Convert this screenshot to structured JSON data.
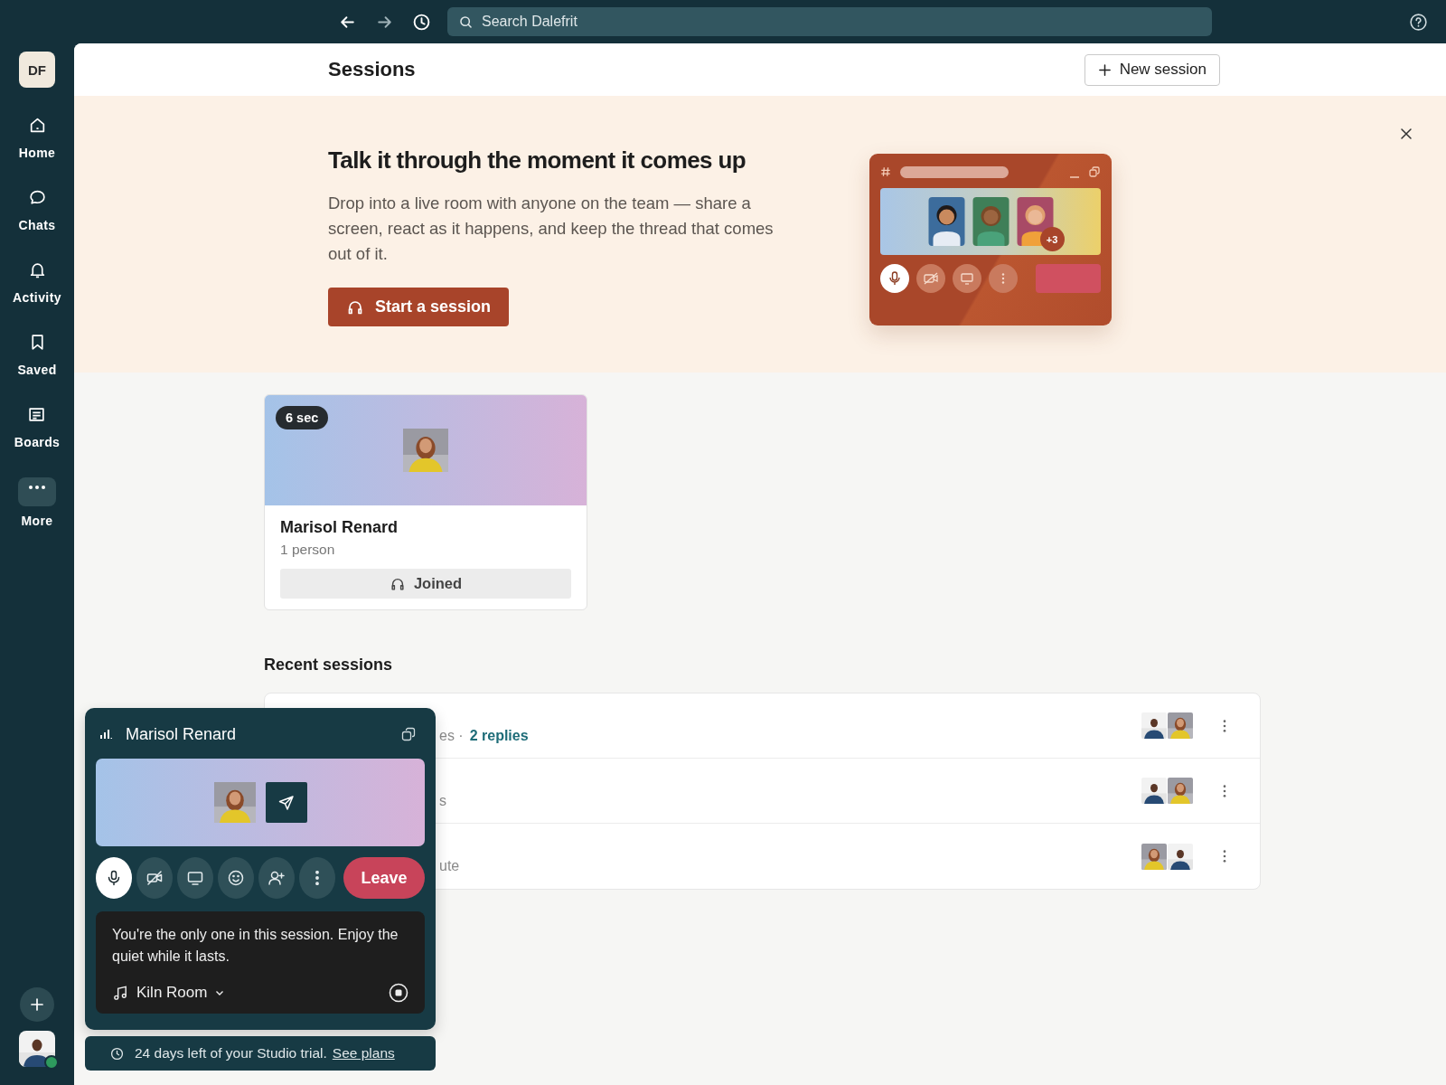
{
  "topbar": {
    "search": {
      "placeholder": "Search Dalefrit"
    }
  },
  "sidebar": {
    "workspace": "DF",
    "items": [
      {
        "label": "Home"
      },
      {
        "label": "Chats"
      },
      {
        "label": "Activity"
      },
      {
        "label": "Saved"
      },
      {
        "label": "Boards"
      },
      {
        "label": "More"
      }
    ]
  },
  "header": {
    "title": "Sessions",
    "new_button": "New session"
  },
  "banner": {
    "title": "Talk it through the moment it comes up",
    "body": "Drop into a live room with anyone on the team — share a screen, react as it happens, and keep the thread that comes out of it.",
    "button": "Start a session",
    "illustration": {
      "extra_count": "+3"
    }
  },
  "live_card": {
    "duration": "6 sec",
    "name": "Marisol Renard",
    "people": "1 person",
    "status": "Joined"
  },
  "recent": {
    "title": "Recent sessions",
    "rows": [
      {
        "text": "es ·",
        "link": "2 replies"
      },
      {
        "text": "s"
      },
      {
        "text": "ute"
      }
    ]
  },
  "call_panel": {
    "name": "Marisol Renard",
    "controls": [
      {
        "kind": "mic",
        "active": true
      },
      {
        "kind": "camera",
        "active": false
      },
      {
        "kind": "screen",
        "active": false
      },
      {
        "kind": "emoji",
        "active": false
      },
      {
        "kind": "invite",
        "active": false
      },
      {
        "kind": "more",
        "active": false
      }
    ],
    "leave": "Leave",
    "message": "You're the only one in this session. Enjoy the quiet while it lasts.",
    "room": "Kiln Room"
  },
  "trial": {
    "text": "24 days left of your Studio trial.",
    "link": "See plans"
  }
}
